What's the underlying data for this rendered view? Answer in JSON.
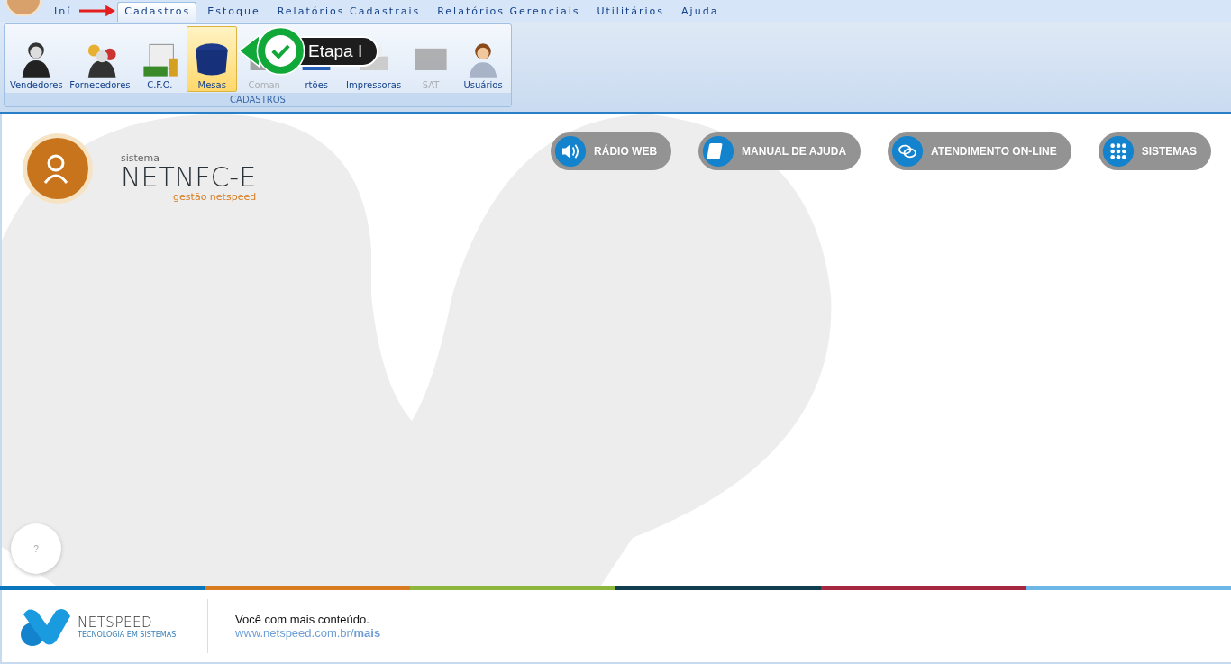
{
  "menu_tabs": [
    {
      "label": "Iní",
      "selected": false
    },
    {
      "label": "Cadastros",
      "selected": true
    },
    {
      "label": "Estoque",
      "selected": false
    },
    {
      "label": "Relatórios Cadastrais",
      "selected": false
    },
    {
      "label": "Relatórios Gerenciais",
      "selected": false
    },
    {
      "label": "Utilitários",
      "selected": false
    },
    {
      "label": "Ajuda",
      "selected": false
    }
  ],
  "ribbon": {
    "items": [
      {
        "label": "Vendedores",
        "selected": false,
        "disabled": false
      },
      {
        "label": "Fornecedores",
        "selected": false,
        "disabled": false
      },
      {
        "label": "C.F.O.",
        "selected": false,
        "disabled": false
      },
      {
        "label": "Mesas",
        "selected": true,
        "disabled": false
      },
      {
        "label": "Coman",
        "selected": false,
        "disabled": true
      },
      {
        "label": "rtões",
        "selected": false,
        "disabled": false
      },
      {
        "label": "Impressoras",
        "selected": false,
        "disabled": false
      },
      {
        "label": "SAT",
        "selected": false,
        "disabled": true
      },
      {
        "label": "Usuários",
        "selected": false,
        "disabled": false
      }
    ],
    "group_label": "CADASTROS"
  },
  "callout": {
    "text": "Etapa I"
  },
  "logo": {
    "caption": "sistema",
    "name": "NETNFC-E",
    "tagline": "gestão netspeed"
  },
  "nav_buttons": [
    {
      "label": "RÁDIO WEB"
    },
    {
      "label": "MANUAL DE AJUDA"
    },
    {
      "label": "ATENDIMENTO ON-LINE"
    },
    {
      "label": "SISTEMAS"
    }
  ],
  "help_button": "?",
  "footer": {
    "brand": "NETSPEED",
    "brand_tagline": "TECNOLOGIA EM SISTEMAS",
    "slogan": "Você com mais conteúdo.",
    "link_base": "www.netspeed.com.br/",
    "link_bold": "mais"
  }
}
